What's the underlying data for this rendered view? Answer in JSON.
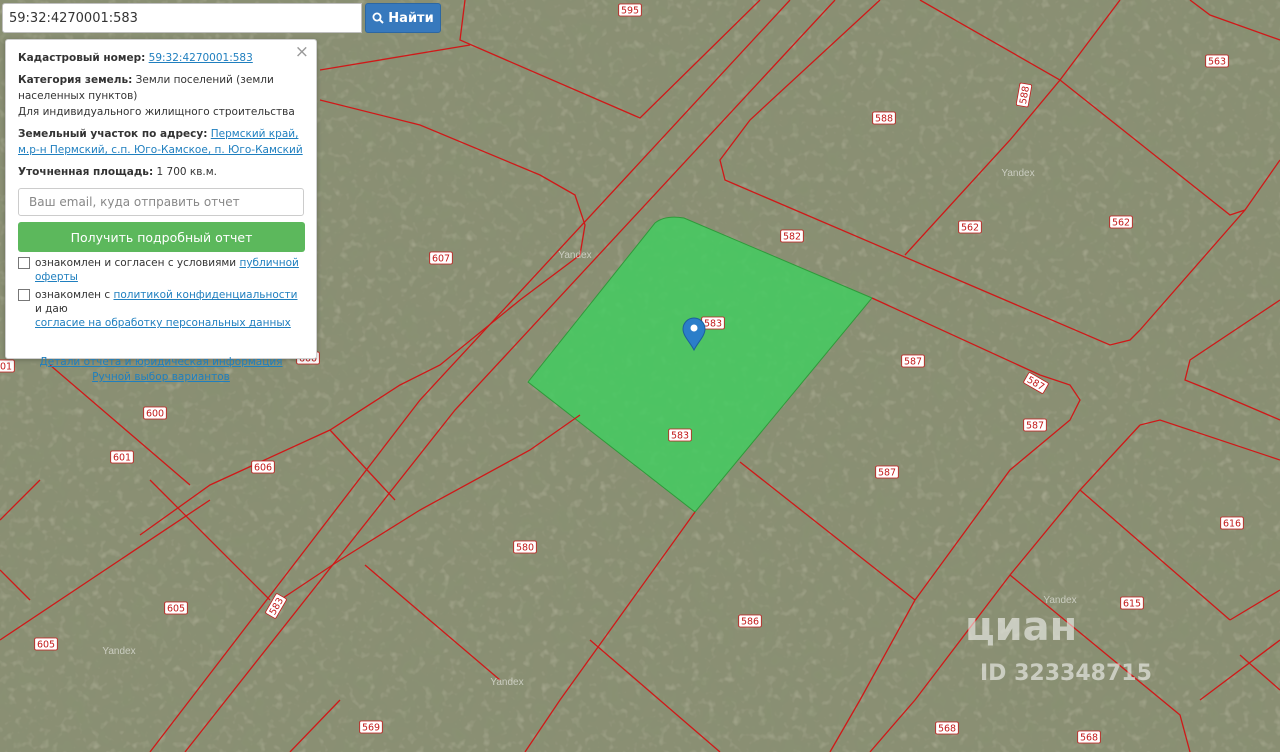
{
  "search": {
    "value": "59:32:4270001:583",
    "button_label": "Найти",
    "button_icon": "search-icon"
  },
  "panel": {
    "close_symbol": "×",
    "cadastral_label": "Кадастровый номер:",
    "cadastral_value": "59:32:4270001:583",
    "category_label": "Категория земель:",
    "category_value": "Земли поселений (земли населенных пунктов)",
    "usage": "Для индивидуального жилищного строительства",
    "address_label": "Земельный участок по адресу:",
    "address_value": "Пермский край, м.р-н Пермский, с.п. Юго-Камское, п. Юго-Камский",
    "area_label": "Уточненная площадь:",
    "area_value": "1 700 кв.м.",
    "email_placeholder": "Ваш email, куда отправить отчет",
    "report_button": "Получить подробный отчет",
    "consent1_text": "ознакомлен и согласен с условиями ",
    "consent1_link": "публичной оферты",
    "consent2_text": "ознакомлен с ",
    "consent2_link1": "политикой конфиденциальности",
    "consent2_mid": " и даю",
    "consent2_link2": "согласие на обработку персональных данных",
    "details_link": "Детали отчета и юридическая информация",
    "manual_link": "Ручной выбор вариантов"
  },
  "map": {
    "selected_parcel_color": "#3fcf5f",
    "boundary_color": "#d01818",
    "marker_color": "#2b7ec9",
    "marker_icon": "map-pin-icon",
    "parcel_labels": [
      "595",
      "563",
      "588",
      "588",
      "562",
      "562",
      "582",
      "607",
      "583",
      "583",
      "587",
      "587",
      "587",
      "587",
      "600",
      "601",
      "606",
      "580",
      "616",
      "605",
      "605",
      "583",
      "586",
      "615",
      "569",
      "568",
      "568",
      "600",
      "601"
    ],
    "yandex_labels": [
      "Yandex",
      "Yandex",
      "Yandex",
      "Yandex",
      "Yandex"
    ],
    "watermark_brand": "циан",
    "watermark_id": "ID 323348715"
  }
}
